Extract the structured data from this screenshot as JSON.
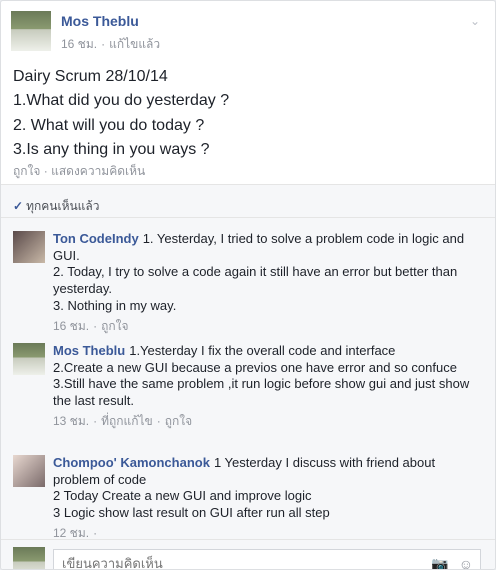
{
  "post": {
    "author": "Mos Theblu",
    "time": "16 ชม.",
    "edited": "แก้ไขแล้ว",
    "body": [
      "Dairy Scrum 28/10/14",
      "1.What did you do yesterday ?",
      "2. What will you do today ?",
      "3.Is any thing in you ways ?"
    ],
    "actions": {
      "like": "ถูกใจ",
      "comment": "แสดงความคิดเห็น"
    }
  },
  "seen": {
    "label": "ทุกคนเห็นแล้ว"
  },
  "comments": [
    {
      "name": "Ton CodeIndy",
      "text": "1. Yesterday, I tried to solve a problem code in logic and GUI.\n2. Today, I try to solve a code again it still have an error but better than yesterday.\n3. Nothing in my way.",
      "time": "16 ชม.",
      "like": "ถูกใจ",
      "edited": ""
    },
    {
      "name": "Mos Theblu",
      "text": "1.Yesterday I fix the overall code and interface\n2.Create a new GUI because a previos one have error and so confuce\n3.Still have the same problem ,it run logic before show gui and just show the last result.",
      "time": "13 ชม.",
      "like": "ถูกใจ",
      "edited": "ที่ถูกแก้ไข"
    },
    {
      "name": "Chompoo' Kamonchanok",
      "text": "1 Yesterday I discuss with friend about problem of code\n2 Today Create a new GUI and improve logic\n3 Logic show last result on GUI after run all step",
      "time": "12 ชม.",
      "like": "",
      "edited": ""
    }
  ],
  "reply": {
    "placeholder": "เขียนความคิดเห็น"
  },
  "colors": {
    "link": "#3b5998",
    "meta": "#90949c"
  }
}
